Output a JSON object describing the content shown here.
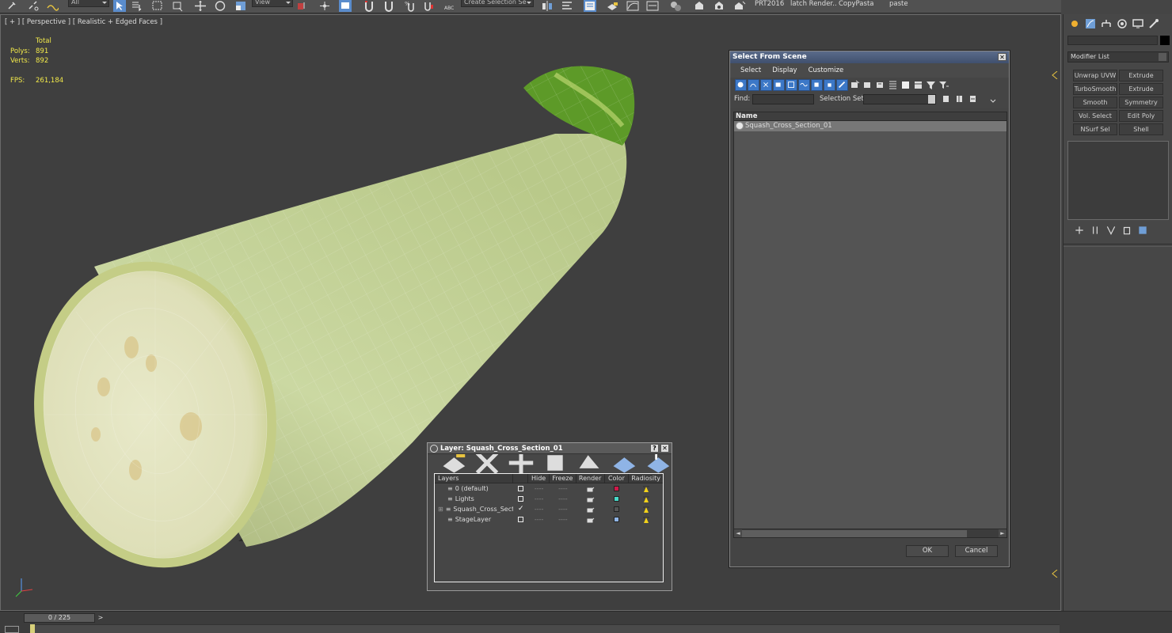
{
  "toolbar": {
    "filter_dropdown": "All",
    "view_dropdown": "View",
    "selection_set": "Create Selection Se",
    "labels": [
      "PRT2016",
      "latch Render..",
      "CopyPasta",
      "paste"
    ]
  },
  "viewport": {
    "label": "[ + ] [ Perspective ] [ Realistic + Edged Faces ]",
    "stats": {
      "header": "Total",
      "polys_label": "Polys:",
      "polys_value": "891",
      "verts_label": "Verts:",
      "verts_value": "892",
      "fps_label": "FPS:",
      "fps_value": "261,184"
    }
  },
  "timeline": {
    "frame": "0 / 225",
    "next": ">"
  },
  "command_panel": {
    "modifier_list": "Modifier List",
    "buttons": [
      "Unwrap UVW",
      "Extrude",
      "TurboSmooth",
      "Extrude",
      "Smooth",
      "Symmetry",
      "Vol. Select",
      "Edit Poly",
      "NSurf Sel",
      "Shell"
    ]
  },
  "select_from_scene": {
    "title": "Select From Scene",
    "close": "✕",
    "menu": [
      "Select",
      "Display",
      "Customize"
    ],
    "find_label": "Find:",
    "selection_set_label": "Selection Set:",
    "column_name": "Name",
    "items": [
      "Squash_Cross_Section_01"
    ],
    "ok": "OK",
    "cancel": "Cancel"
  },
  "layer_dialog": {
    "title": "Layer: Squash_Cross_Section_01",
    "help": "?",
    "close": "✕",
    "columns": [
      "Layers",
      "",
      "Hide",
      "Freeze",
      "Render",
      "Color",
      "Radiosity"
    ],
    "rows": [
      {
        "name": "0 (default)",
        "check": "box",
        "color": "#d0194a"
      },
      {
        "name": "Lights",
        "check": "box",
        "color": "#48d8c8"
      },
      {
        "name": "Squash_Cross_Sect",
        "check": "tick",
        "color": "#555555"
      },
      {
        "name": "StageLayer",
        "check": "box",
        "color": "#8fb4e6"
      }
    ],
    "dash": "----"
  },
  "colors": {
    "accent_blue": "#3c78c7",
    "stats_yellow": "#f2e94a",
    "squash_green": "#c9d7a2",
    "stem_green": "#5d9a28"
  }
}
